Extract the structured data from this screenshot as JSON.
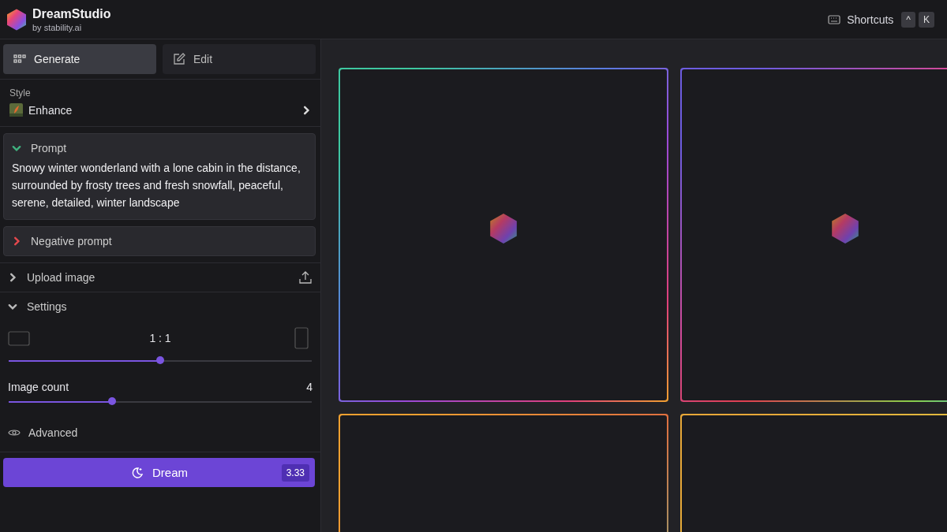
{
  "brand": {
    "title": "DreamStudio",
    "subtitle": "by stability.ai"
  },
  "header": {
    "shortcuts_label": "Shortcuts",
    "keys": [
      "^",
      "K"
    ]
  },
  "tabs": [
    {
      "label": "Generate",
      "kind": "grid",
      "selected": true
    },
    {
      "label": "Edit",
      "kind": "edit",
      "selected": false
    }
  ],
  "style": {
    "label": "Style",
    "value": "Enhance"
  },
  "prompt": {
    "label": "Prompt",
    "expanded": true,
    "color": "#3fb27f",
    "text": "Snowy winter wonderland with a lone cabin in the distance, surrounded by frosty trees and fresh snowfall, peaceful, serene, detailed, winter landscape"
  },
  "negative_prompt": {
    "label": "Negative prompt",
    "expanded": false,
    "color": "#e5484d"
  },
  "upload": {
    "label": "Upload image",
    "expanded": false
  },
  "settings": {
    "label": "Settings",
    "expanded": true,
    "aspect": {
      "reading": "1 : 1",
      "level": 0.5
    },
    "image_count": {
      "label": "Image count",
      "reading": "4",
      "level": 0.34
    },
    "advanced": {
      "label": "Advanced"
    }
  },
  "dream_button": {
    "label": "Dream",
    "cost": "3.33"
  },
  "tiles": [
    {
      "loading": true,
      "color": "#3ec8a0"
    },
    {
      "loading": true,
      "color": "#6d5ce0"
    },
    {
      "color": "#f0a030"
    },
    {
      "color": "#e8a838"
    }
  ]
}
